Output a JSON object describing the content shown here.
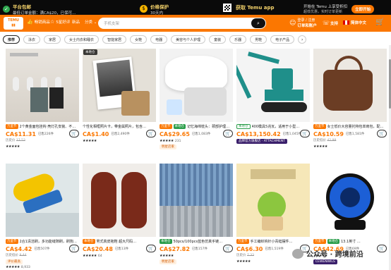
{
  "banner": {
    "free_shipping_title": "平台包邮",
    "free_shipping_sub": "最低订单金额：满CA$20，已保可…",
    "price_adjust_title": "价格保护",
    "price_adjust_sub": "30天内",
    "app_label": "获取 Temu app",
    "notify_title": "开始在 Temu 上享受折扣",
    "notify_sub": "超低优惠，实时订单更新",
    "notify_button": "立即开始"
  },
  "header": {
    "logo": "TEMU",
    "nav": [
      {
        "icon": "thumbs-up-icon",
        "label": "畅销商品"
      },
      {
        "icon": "star-icon",
        "label": "5星好评"
      },
      {
        "icon": "new-icon",
        "label": "新品"
      },
      {
        "icon": "category-icon",
        "label": "分类 ⌄"
      }
    ],
    "search_placeholder": "手机支架",
    "account_line1": "登录 / 注册",
    "account_line2": "订单和账户",
    "support": "支持",
    "language": "简体中文"
  },
  "categories": [
    {
      "label": "推荐",
      "active": true
    },
    {
      "label": "泳衣",
      "active": false
    },
    {
      "label": "家居",
      "active": false
    },
    {
      "label": "女士内衣和睡衣",
      "active": false
    },
    {
      "label": "智能家居",
      "active": false
    },
    {
      "label": "女鞋",
      "active": false
    },
    {
      "label": "电器",
      "active": false
    },
    {
      "label": "美容与个人护理",
      "active": false
    },
    {
      "label": "童装",
      "active": false
    },
    {
      "label": "乐器",
      "active": false
    },
    {
      "label": "男鞋",
      "active": false
    },
    {
      "label": "电子产品",
      "active": false
    }
  ],
  "products": [
    {
      "local": "",
      "badges": [
        {
          "t": "万圣节",
          "c": "orange"
        }
      ],
      "title": "2个黄金面包挂钩 壳灯孔安装、不…",
      "price": "CA$11.31",
      "sold": "已售226件",
      "hist_label": "历史价",
      "hist_price": "17.53",
      "stars": "★★★★★",
      "count": "",
      "store": ""
    },
    {
      "local": "本地仓",
      "badges": [],
      "title": "个性化相框照片卡，带金属照片，包含…",
      "price": "CA$1.40",
      "sold": "已售2,490件",
      "hist_label": "",
      "hist_price": "",
      "stars": "★★★★★",
      "count": "",
      "store": ""
    },
    {
      "local": "",
      "badges": [
        {
          "t": "万圣节",
          "c": "orange"
        },
        {
          "t": "本地仓",
          "c": "green"
        }
      ],
      "title": "记忆海绵枕头：颈部护理型记忆枕头…",
      "price": "CA$29.65",
      "sold": "已售1,083件",
      "hist_label": "",
      "hist_price": "",
      "stars": "★★★★★",
      "count": "231",
      "store": "明星店家"
    },
    {
      "local": "",
      "badges": [
        {
          "t": "本地仓",
          "c": "outline-g"
        }
      ],
      "title": "400模具5兆瓦，适用于小型…",
      "price": "CA$13,150.42",
      "sold": "已售1,045件",
      "hist_label": "",
      "hist_price": "",
      "stars": "",
      "count": "",
      "store": "品牌官方旗舰店 · ATTACHMENT"
    },
    {
      "local": "",
      "badges": [
        {
          "t": "万圣节",
          "c": "orange"
        }
      ],
      "title": "女士低价大容量托特包单肩包，配件…",
      "price": "CA$10.59",
      "sold": "已售1,581件",
      "hist_label": "历史低价",
      "hist_price": "42.99",
      "stars": "★★★★★",
      "count": "",
      "store": ""
    },
    {
      "local": "",
      "badges": [
        {
          "t": "万圣节",
          "c": "orange"
        }
      ],
      "title": "2合1清洁刷，多功能缝隙刷，刷狗…",
      "price": "CA$4.42",
      "sold": "已售507件",
      "hist_label": "历史低价",
      "hist_price": "9.44",
      "stars": "★★★★★",
      "count": "8,933",
      "store": "评价最高"
    },
    {
      "local": "",
      "badges": [
        {
          "t": "本地仓",
          "c": "orange"
        }
      ],
      "title": "男式真皮拖鞋 超大尺码…",
      "price": "CA$20.48",
      "sold": "已售13件",
      "hist_label": "",
      "hist_price": "",
      "stars": "★★★★★",
      "count": "64",
      "store": ""
    },
    {
      "local": "",
      "badges": [
        {
          "t": "本地仓",
          "c": "green"
        }
      ],
      "title": "50pcs/100pcs蓝色仿真手链…",
      "price": "CA$27.82",
      "sold": "已售157件",
      "hist_label": "",
      "hist_price": "",
      "stars": "★★★★★",
      "count": "",
      "store": "明星店家"
    },
    {
      "local": "",
      "badges": [
        {
          "t": "万圣节",
          "c": "orange"
        }
      ],
      "title": "手工编织钩针小青蛙摆件…",
      "price": "CA$6.30",
      "sold": "已售1,519件",
      "hist_label": "历史价",
      "hist_price": "7.33",
      "stars": "★★★★★",
      "count": "",
      "store": ""
    },
    {
      "local": "",
      "badges": [
        {
          "t": "万圣节",
          "c": "orange"
        },
        {
          "t": "本地仓",
          "c": "green"
        }
      ],
      "title": "13.1英寸 …",
      "price": "CA$42.69",
      "sold": "已售69件",
      "hist_label": "",
      "hist_price": "",
      "stars": "★★★★★",
      "count": "",
      "store": "CEWENWILS"
    }
  ],
  "watermark": {
    "text": "公众号 · 跨境前沿"
  }
}
